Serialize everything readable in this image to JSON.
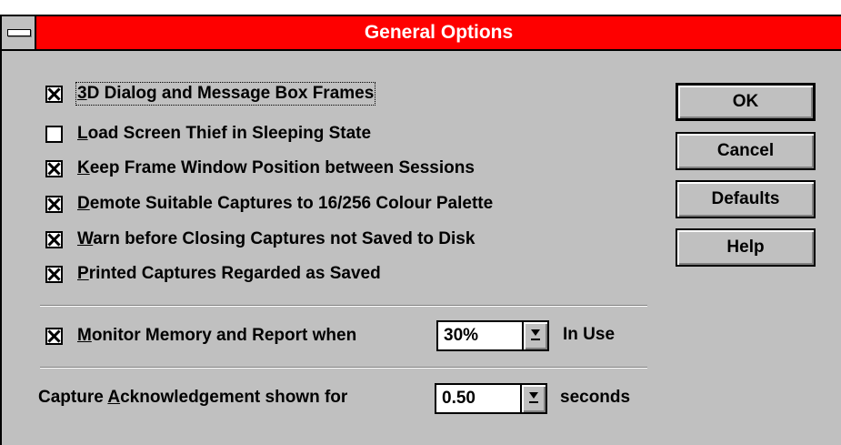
{
  "window": {
    "title": "General Options"
  },
  "options": [
    {
      "accel": "3",
      "rest": "D Dialog and Message Box Frames",
      "checked": true
    },
    {
      "accel": "L",
      "rest": "oad Screen Thief in Sleeping State",
      "checked": false
    },
    {
      "accel": "K",
      "rest": "eep Frame Window Position between Sessions",
      "checked": true
    },
    {
      "accel": "D",
      "rest": "emote Suitable Captures to 16/256 Colour Palette",
      "checked": true
    },
    {
      "accel": "W",
      "rest": "arn before Closing Captures not Saved to Disk",
      "checked": true
    },
    {
      "accel": "P",
      "rest": "rinted Captures Regarded as Saved",
      "checked": true
    }
  ],
  "memory": {
    "accel": "M",
    "rest": "onitor Memory and Report when",
    "checked": true,
    "value": "30%",
    "suffix": "In Use"
  },
  "ack": {
    "prefix_a": "Capture ",
    "accel": "A",
    "prefix_b": "cknowledgement shown for",
    "value": "0.50",
    "suffix": "seconds"
  },
  "buttons": {
    "ok": "OK",
    "cancel": "Cancel",
    "defaults": "Defaults",
    "help": "Help"
  }
}
